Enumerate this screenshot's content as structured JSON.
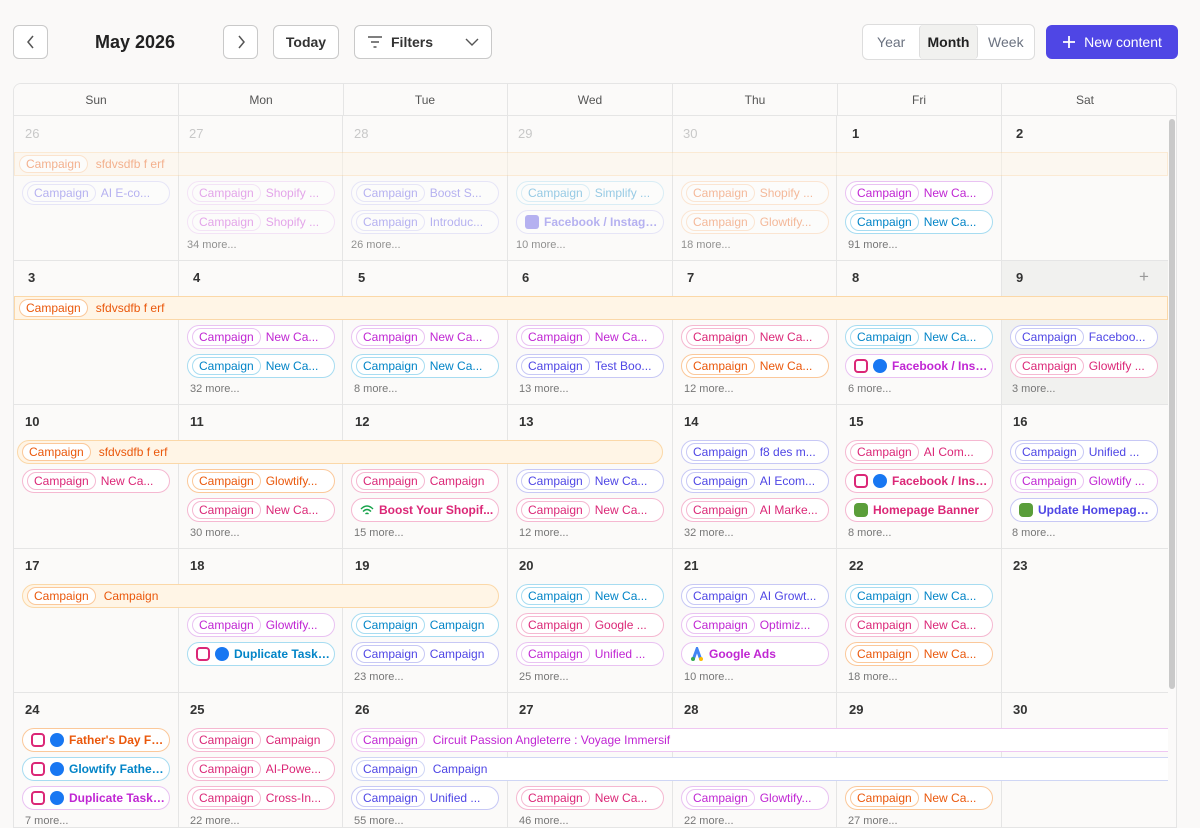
{
  "toolbar": {
    "month_label": "May 2026",
    "today_label": "Today",
    "filters_label": "Filters",
    "views": [
      "Year",
      "Month",
      "Week"
    ],
    "active_view": "Month",
    "new_content_label": "New content"
  },
  "weekdays": [
    "Sun",
    "Mon",
    "Tue",
    "Wed",
    "Thu",
    "Fri",
    "Sat"
  ],
  "weeks": [
    [
      "26",
      "27",
      "28",
      "29",
      "30",
      "1",
      "2"
    ],
    [
      "3",
      "4",
      "5",
      "6",
      "7",
      "8",
      "9"
    ],
    [
      "10",
      "11",
      "12",
      "13",
      "14",
      "15",
      "16"
    ],
    [
      "17",
      "18",
      "19",
      "20",
      "21",
      "22",
      "23"
    ],
    [
      "24",
      "25",
      "26",
      "27",
      "28",
      "29",
      "30"
    ]
  ],
  "colors": {
    "accent": "#4f46e5",
    "purple": "#c026d3",
    "blue": "#0284c7",
    "pink": "#db2777",
    "orange": "#ea580c",
    "indigo": "#4f46e5"
  },
  "tag": "Campaign",
  "spans": {
    "w1": "sfdvsdfb f erf",
    "w2": "sfdvsdfb f erf",
    "w3": "sfdvsdfb f erf",
    "w4": "Campaign",
    "w5a": "Circuit Passion Angleterre : Voyage Immersif",
    "w5b": "Campaign"
  },
  "events": {
    "w1": [
      "AI E-co...",
      "Shopify ...",
      "Shopify ...",
      "Boost S...",
      "Introduc...",
      "Simplify ...",
      "Facebook / Instagr...",
      "Shopify ...",
      "Glowtify...",
      "New Ca...",
      "New Ca..."
    ],
    "w2": [
      "New Ca...",
      "New Ca...",
      "New Ca...",
      "New Ca...",
      "New Ca...",
      "Test Boo...",
      "New Ca...",
      "New Ca...",
      "New Ca...",
      "Facebook / Inst...",
      "Faceboo...",
      "Glowtify ..."
    ],
    "w3": [
      "New Ca...",
      "Glowtify...",
      "New Ca...",
      "Campaign",
      "Boost Your Shopif...",
      "New Ca...",
      "New Ca...",
      "f8 des m...",
      "AI Ecom...",
      "AI Marke...",
      "AI Com...",
      "Facebook / Inst...",
      "Homepage Banner",
      "Unified ...",
      "Glowtify ...",
      "Update Homepage..."
    ],
    "w4": [
      "Glowtify...",
      "Duplicate Task ...",
      "Campaign",
      "Campaign",
      "New Ca...",
      "Google ...",
      "Unified ...",
      "AI Growt...",
      "Optimiz...",
      "Google Ads",
      "New Ca...",
      "New Ca...",
      "New Ca..."
    ],
    "w5": [
      "Father's Day Fo...",
      "Glowtify Father'...",
      "Duplicate Task ...",
      "Campaign",
      "AI-Powe...",
      "Cross-In...",
      "Unified ...",
      "New Ca...",
      "Glowtify...",
      "New Ca..."
    ]
  },
  "more": {
    "w1": [
      "34 more...",
      "26 more...",
      "10 more...",
      "18 more...",
      "91 more..."
    ],
    "w2": [
      "32 more...",
      "8 more...",
      "13 more...",
      "12 more...",
      "6 more...",
      "3 more..."
    ],
    "w3": [
      "30 more...",
      "15 more...",
      "12 more...",
      "32 more...",
      "8 more...",
      "8 more..."
    ],
    "w4": [
      "23 more...",
      "25 more...",
      "10 more...",
      "18 more..."
    ],
    "w5": [
      "7 more...",
      "22 more...",
      "55 more...",
      "46 more...",
      "22 more...",
      "27 more..."
    ]
  }
}
